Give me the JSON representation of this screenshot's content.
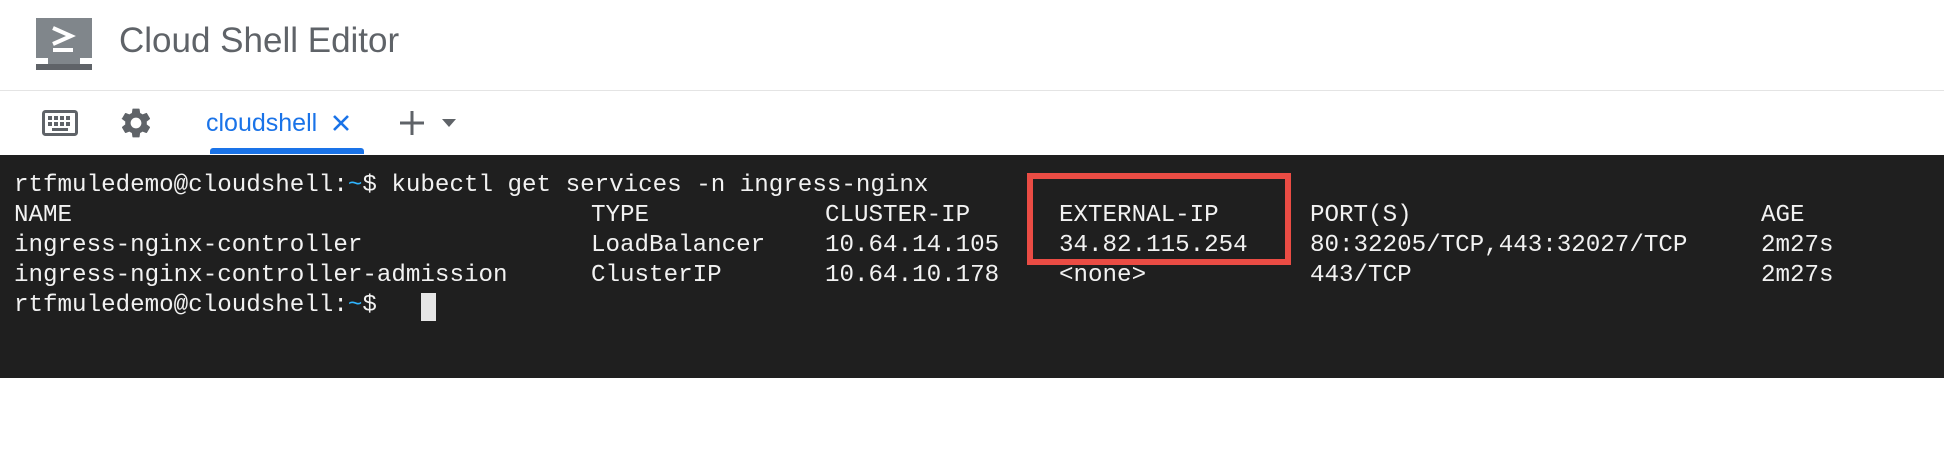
{
  "header": {
    "title": "Cloud Shell Editor",
    "logo_icon": "cloud-shell-terminal-icon"
  },
  "tabbar": {
    "keyboard_icon": "keyboard-icon",
    "settings_icon": "gear-icon",
    "active_tab": {
      "label": "cloudshell",
      "close_icon": "close-icon"
    },
    "add_icon": "plus-icon",
    "add_menu_icon": "caret-down-icon"
  },
  "terminal": {
    "prompt": {
      "user_host": "rtfmuledemo@cloudshell:",
      "path": "~",
      "symbol": "$"
    },
    "command": " kubectl get services -n ingress-nginx",
    "headers": {
      "name": "NAME",
      "type": "TYPE",
      "cluster_ip": "CLUSTER-IP",
      "external_ip": "EXTERNAL-IP",
      "ports": "PORT(S)",
      "age": "AGE"
    },
    "rows": [
      {
        "name": "ingress-nginx-controller",
        "type": "LoadBalancer",
        "cluster_ip": "10.64.14.105",
        "external_ip": "34.82.115.254",
        "ports": "80:32205/TCP,443:32027/TCP",
        "age": "2m27s"
      },
      {
        "name": "ingress-nginx-controller-admission",
        "type": "ClusterIP",
        "cluster_ip": "10.64.10.178",
        "external_ip": "<none>",
        "ports": "443/TCP",
        "age": "2m27s"
      }
    ]
  },
  "colors": {
    "accent": "#1a73e8",
    "terminal_bg": "#1f1f1f",
    "prompt_path": "#2fb5ff",
    "highlight": "#ea4c44"
  }
}
